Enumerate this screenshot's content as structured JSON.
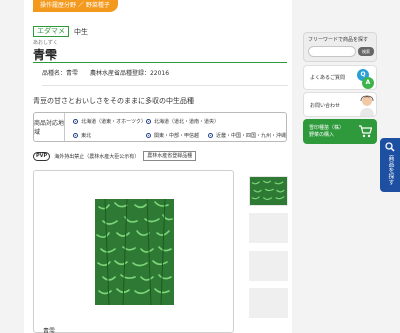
{
  "breadcrumb": {
    "label": "操作履歴分野 ／ 野菜種子"
  },
  "product": {
    "category_tag": "エダマメ",
    "maturity": "中生",
    "name_ruby": "あおしずく",
    "name": "青雫",
    "meta": [
      "品種名：青雫",
      "農林水産省品種登録：22016"
    ],
    "description": "青豆の甘さとおいしさをそのままに多収の中生品種"
  },
  "region": {
    "label": "商品対応地域",
    "items": [
      "北海道（道東・オホーツク）",
      "北海道（道北・道南・道央）",
      "東北",
      "関東・中部・甲信越",
      "近畿・中国・四国・九州・沖縄"
    ]
  },
  "pvp": {
    "badge": "PVP",
    "text": "海外持出禁止（農林水産大臣公示有）",
    "button": "農林水産省登録品種"
  },
  "viewer": {
    "caption": "青雫"
  },
  "sidebar": {
    "search_title": "フリーワードで商品を探す",
    "search_placeholder": "",
    "search_button": "検索",
    "faq_label": "よくあるご質問",
    "faq_q": "Q",
    "faq_a": "A",
    "contact_label": "お問い合わせ",
    "buy_line1": "雪印種苗（株）",
    "buy_line2": "野菜の購入"
  },
  "float": {
    "label": "商品を探す"
  },
  "colors": {
    "accent_orange": "#f39a1e",
    "brand_green": "#2f9a3c",
    "navy": "#1e50a2"
  }
}
